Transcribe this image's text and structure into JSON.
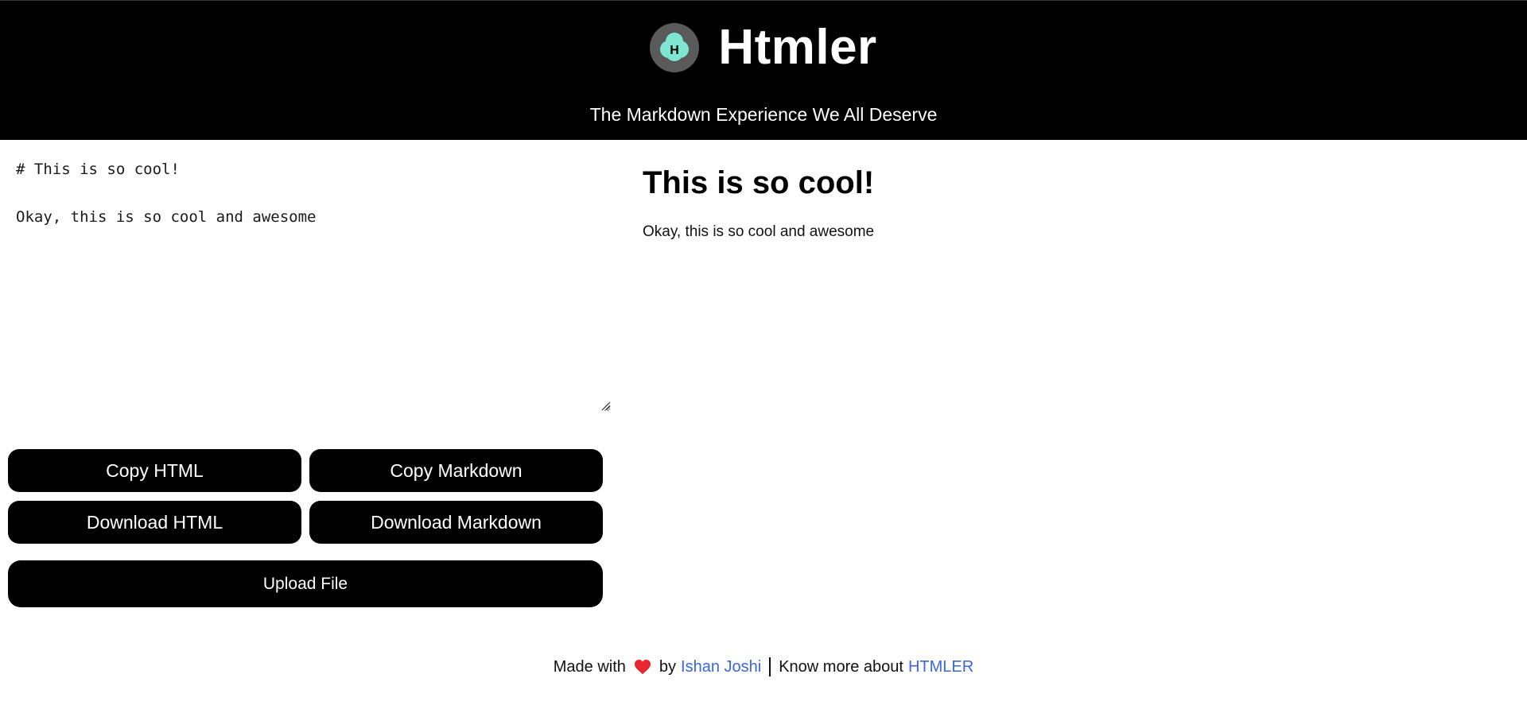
{
  "header": {
    "title": "Htmler",
    "logo_letter": "H",
    "tagline": "The Markdown Experience We All Deserve",
    "background": "#000000",
    "logo_accent": "#7fe6d4"
  },
  "editor": {
    "content": "# This is so cool!\n\nOkay, this is so cool and awesome"
  },
  "buttons": {
    "copy_html": "Copy HTML",
    "copy_markdown": "Copy Markdown",
    "download_html": "Download HTML",
    "download_markdown": "Download Markdown",
    "upload_file": "Upload File"
  },
  "preview": {
    "heading": "This is so cool!",
    "paragraph": "Okay, this is so cool and awesome"
  },
  "footer": {
    "made_with": "Made with",
    "heart_icon": "heart-icon",
    "by": "by",
    "author": "Ishan Joshi",
    "know_more": "Know more about",
    "project_link": "HTMLER",
    "link_color": "#3a66e0"
  }
}
